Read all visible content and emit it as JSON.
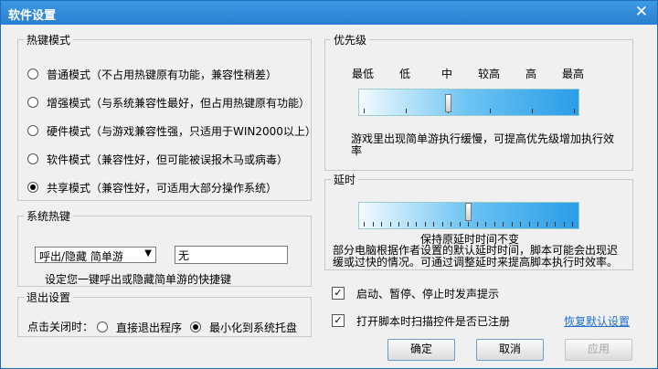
{
  "window": {
    "title": "软件设置"
  },
  "hotkey_mode": {
    "title": "热键模式",
    "options": [
      {
        "label": "普通模式（不占用热键原有功能，兼容性稍差）",
        "selected": false
      },
      {
        "label": "增强模式（与系统兼容性最好，但占用热键原有功能）",
        "selected": false
      },
      {
        "label": "硬件模式（与游戏兼容性强，只适用于WIN2000以上）",
        "selected": false
      },
      {
        "label": "软件模式（兼容性好，但可能被误报木马或病毒）",
        "selected": false
      },
      {
        "label": "共享模式（兼容性好，可适用大部分操作系统）",
        "selected": true
      }
    ]
  },
  "system_hotkey": {
    "title": "系统热键",
    "action": "呼出/隐藏 简单游",
    "key_value": "无",
    "hint": "设定您一键呼出或隐藏简单游的快捷键"
  },
  "exit_settings": {
    "title": "退出设置",
    "label": "点击关闭时：",
    "options": [
      {
        "label": "直接退出程序",
        "selected": false
      },
      {
        "label": "最小化到系统托盘",
        "selected": true
      }
    ]
  },
  "priority": {
    "title": "优先级",
    "levels": [
      "最低",
      "低",
      "中",
      "较高",
      "高",
      "最高"
    ],
    "value_index": 2,
    "description": "游戏里出现简单游执行缓慢，可提高优先级增加执行效率"
  },
  "delay": {
    "title": "延时",
    "status": "保持原延时时间不变",
    "description": "部分电脑根据作者设置的默认延时时间，脚本可能会出现迟缓或过快的情况。可通过调整延时来提高脚本执行时效率。"
  },
  "options": [
    {
      "label": "启动、暂停、停止时发声提示",
      "checked": true
    },
    {
      "label": "打开脚本时扫描控件是否已注册",
      "checked": true
    }
  ],
  "restore_default": "恢复默认设置",
  "buttons": {
    "ok": "确定",
    "cancel": "取消",
    "apply": "应用"
  }
}
